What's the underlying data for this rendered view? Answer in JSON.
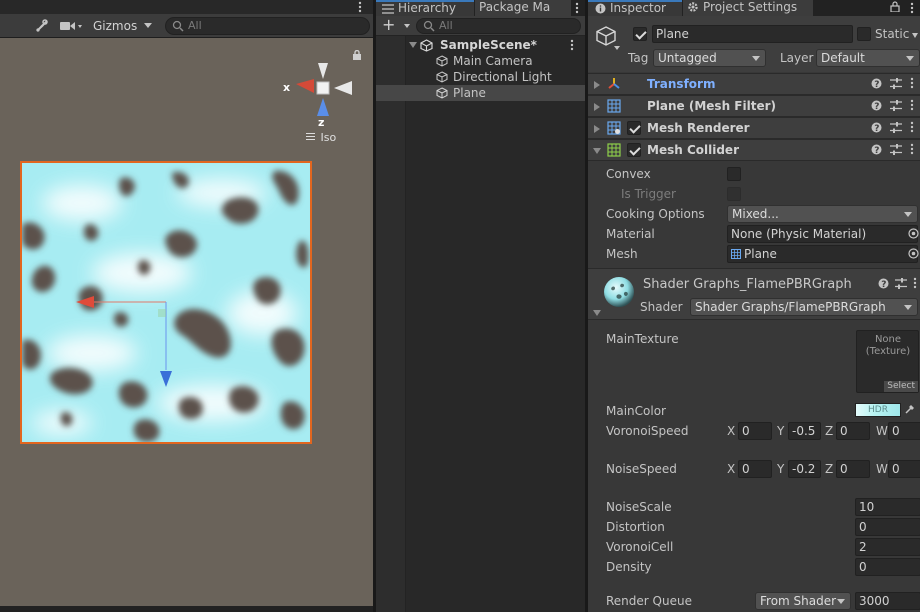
{
  "scene": {
    "toolbar": {
      "gizmos_label": "Gizmos",
      "search_placeholder": "All"
    },
    "gizmo": {
      "x_label": "x",
      "z_label": "z",
      "projection_label": "Iso"
    },
    "colors": {
      "viewport": "#6a635a",
      "selection_outline": "#e2661f",
      "water": "#b7f1f5",
      "spots": "#5a514b"
    }
  },
  "hierarchy": {
    "tabs": [
      {
        "label": "Hierarchy",
        "icon": "list-icon"
      },
      {
        "label": "Package Ma"
      }
    ],
    "search_placeholder": "All",
    "add_label": "+",
    "scene_name": "SampleScene*",
    "items": [
      {
        "label": "Main Camera",
        "icon": "gameobject-cube-icon"
      },
      {
        "label": "Directional Light",
        "icon": "gameobject-cube-icon"
      },
      {
        "label": "Plane",
        "icon": "gameobject-cube-icon",
        "selected": true
      }
    ]
  },
  "inspector": {
    "tabs": [
      {
        "label": "Inspector",
        "icon": "info-icon"
      },
      {
        "label": "Project Settings",
        "icon": "gear-icon"
      }
    ],
    "object": {
      "active": true,
      "name": "Plane",
      "static_label": "Static",
      "tag_label": "Tag",
      "tag_value": "Untagged",
      "layer_label": "Layer",
      "layer_value": "Default"
    },
    "components": [
      {
        "title": "Transform",
        "icon": "transform-icon",
        "has_checkbox": false,
        "expanded": false,
        "accent": true
      },
      {
        "title": "Plane (Mesh Filter)",
        "icon": "mesh-filter-icon",
        "has_checkbox": false,
        "expanded": false
      },
      {
        "title": "Mesh Renderer",
        "icon": "mesh-renderer-icon",
        "has_checkbox": true,
        "enabled": true,
        "expanded": false
      },
      {
        "title": "Mesh Collider",
        "icon": "mesh-collider-icon",
        "has_checkbox": true,
        "enabled": true,
        "expanded": true
      }
    ],
    "mesh_collider": {
      "convex_label": "Convex",
      "is_trigger_label": "Is Trigger",
      "cooking_label": "Cooking Options",
      "cooking_value": "Mixed...",
      "material_label": "Material",
      "material_value": "None (Physic Material)",
      "mesh_label": "Mesh",
      "mesh_value": "Plane"
    },
    "material": {
      "name": "Shader Graphs_FlamePBRGraph",
      "shader_label": "Shader",
      "shader_value": "Shader Graphs/FlamePBRGraph",
      "main_texture_label": "MainTexture",
      "texture_none": "None",
      "texture_type": "(Texture)",
      "texture_select": "Select",
      "main_color_label": "MainColor",
      "hdr_label": "HDR",
      "voronoi_speed_label": "VoronoiSpeed",
      "voronoi_speed": {
        "x": "0",
        "y": "-0.5",
        "z": "0",
        "w": "0"
      },
      "noise_speed_label": "NoiseSpeed",
      "noise_speed": {
        "x": "0",
        "y": "-0.2",
        "z": "0",
        "w": "0"
      },
      "axis": {
        "x": "X",
        "y": "Y",
        "z": "Z",
        "w": "W"
      },
      "noise_scale_label": "NoiseScale",
      "noise_scale": "10",
      "distortion_label": "Distortion",
      "distortion": "0",
      "voronoi_cell_label": "VoronoiCell",
      "voronoi_cell": "2",
      "density_label": "Density",
      "density": "0",
      "render_queue_label": "Render Queue",
      "render_queue_mode": "From Shader",
      "render_queue_value": "3000"
    },
    "colors": {
      "accent_link": "#7fb0ff",
      "tab_highlight": "#3a79bb",
      "main_color": "#b9f3f2"
    }
  }
}
